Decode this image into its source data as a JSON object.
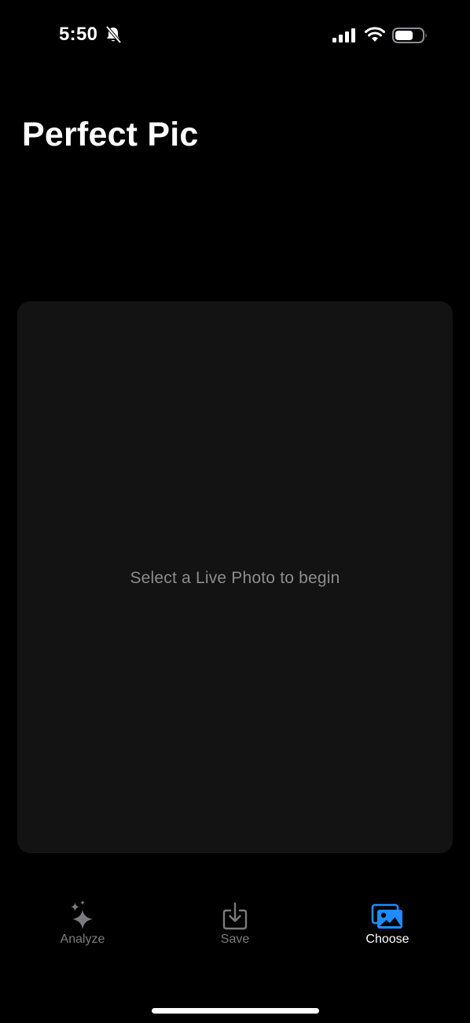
{
  "status_bar": {
    "time": "5:50",
    "silent_icon": "bell-slash-icon",
    "signal_icon": "cellular-signal-icon",
    "wifi_icon": "wifi-icon",
    "battery_icon": "battery-icon"
  },
  "header": {
    "title": "Perfect Pic"
  },
  "main": {
    "placeholder": "Select a Live Photo to begin"
  },
  "toolbar": {
    "analyze_label": "Analyze",
    "analyze_icon": "sparkles-icon",
    "save_label": "Save",
    "save_icon": "download-tray-icon",
    "choose_label": "Choose",
    "choose_icon": "photo-stack-icon",
    "accent_color": "#1e8cff",
    "muted_color": "#7b7b7e"
  }
}
